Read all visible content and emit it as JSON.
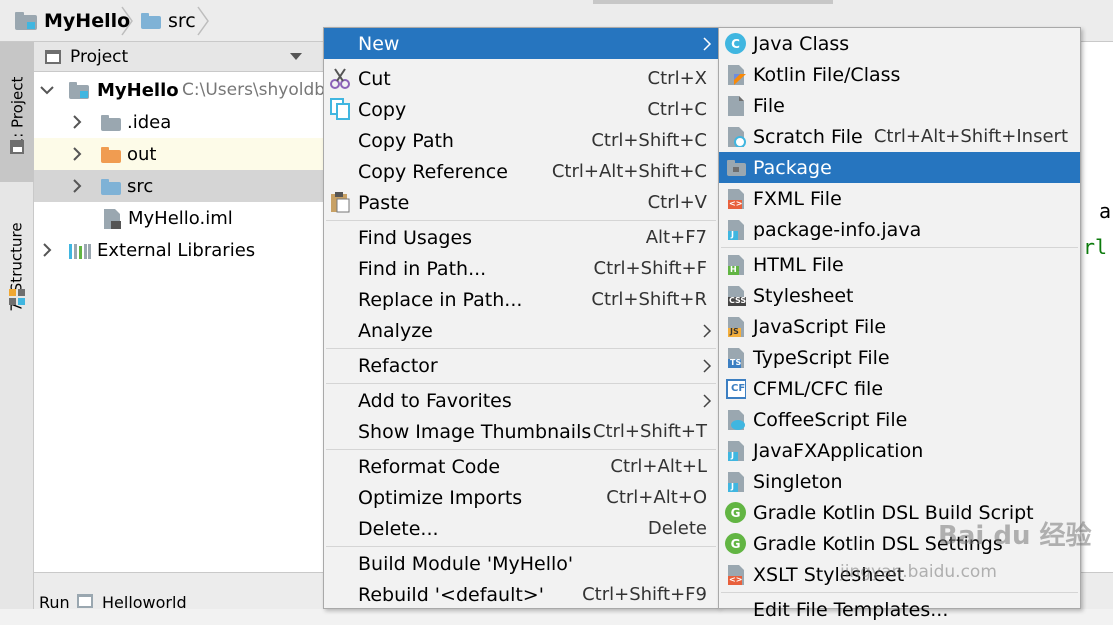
{
  "breadcrumb": {
    "project": "MyHello",
    "folder": "src"
  },
  "tool_windows": {
    "project_tab": "1: Project",
    "structure_tab": "7: Structure"
  },
  "project_panel": {
    "header": "Project",
    "tree": [
      {
        "name": "MyHello",
        "path": "C:\\Users\\shyoldb",
        "icon": "module-folder-icon"
      },
      {
        "name": ".idea",
        "icon": "folder-icon"
      },
      {
        "name": "out",
        "icon": "excluded-folder-icon"
      },
      {
        "name": "src",
        "icon": "source-folder-icon"
      },
      {
        "name": "MyHello.iml",
        "icon": "iml-file-icon"
      },
      {
        "name": "External Libraries",
        "icon": "libraries-icon"
      }
    ]
  },
  "editor_fragment": {
    "line1": "a",
    "line2": "rl"
  },
  "bottom_bar": {
    "run": "Run",
    "config": "Helloworld"
  },
  "context_menu": {
    "items": [
      {
        "label": "New",
        "shortcut": "",
        "submenu": true
      },
      {
        "label": "Cut",
        "shortcut": "Ctrl+X"
      },
      {
        "label": "Copy",
        "shortcut": "Ctrl+C"
      },
      {
        "label": "Copy Path",
        "shortcut": "Ctrl+Shift+C"
      },
      {
        "label": "Copy Reference",
        "shortcut": "Ctrl+Alt+Shift+C"
      },
      {
        "label": "Paste",
        "shortcut": "Ctrl+V"
      },
      {
        "label": "Find Usages",
        "shortcut": "Alt+F7"
      },
      {
        "label": "Find in Path...",
        "shortcut": "Ctrl+Shift+F"
      },
      {
        "label": "Replace in Path...",
        "shortcut": "Ctrl+Shift+R"
      },
      {
        "label": "Analyze",
        "shortcut": "",
        "submenu": true
      },
      {
        "label": "Refactor",
        "shortcut": "",
        "submenu": true
      },
      {
        "label": "Add to Favorites",
        "shortcut": "",
        "submenu": true
      },
      {
        "label": "Show Image Thumbnails",
        "shortcut": "Ctrl+Shift+T"
      },
      {
        "label": "Reformat Code",
        "shortcut": "Ctrl+Alt+L"
      },
      {
        "label": "Optimize Imports",
        "shortcut": "Ctrl+Alt+O"
      },
      {
        "label": "Delete...",
        "shortcut": "Delete"
      },
      {
        "label": "Build Module 'MyHello'",
        "shortcut": ""
      },
      {
        "label": "Rebuild '<default>'",
        "shortcut": "Ctrl+Shift+F9"
      }
    ]
  },
  "new_submenu": {
    "items": [
      {
        "label": "Java Class",
        "shortcut": ""
      },
      {
        "label": "Kotlin File/Class",
        "shortcut": ""
      },
      {
        "label": "File",
        "shortcut": ""
      },
      {
        "label": "Scratch File",
        "shortcut": "Ctrl+Alt+Shift+Insert"
      },
      {
        "label": "Package",
        "shortcut": ""
      },
      {
        "label": "FXML File",
        "shortcut": ""
      },
      {
        "label": "package-info.java",
        "shortcut": ""
      },
      {
        "label": "HTML File",
        "shortcut": ""
      },
      {
        "label": "Stylesheet",
        "shortcut": ""
      },
      {
        "label": "JavaScript File",
        "shortcut": ""
      },
      {
        "label": "TypeScript File",
        "shortcut": ""
      },
      {
        "label": "CFML/CFC file",
        "shortcut": ""
      },
      {
        "label": "CoffeeScript File",
        "shortcut": ""
      },
      {
        "label": "JavaFXApplication",
        "shortcut": ""
      },
      {
        "label": "Singleton",
        "shortcut": ""
      },
      {
        "label": "Gradle Kotlin DSL Build Script",
        "shortcut": ""
      },
      {
        "label": "Gradle Kotlin DSL Settings",
        "shortcut": ""
      },
      {
        "label": "XSLT Stylesheet",
        "shortcut": ""
      },
      {
        "label": "Edit File Templates...",
        "shortcut": ""
      }
    ],
    "icon_badges": {
      "java": "C",
      "html": "H",
      "css": "CSS",
      "js": "JS",
      "ts": "TS",
      "cf": "CF",
      "j": "J",
      "g": "G",
      "xml": "<>"
    }
  },
  "watermark": {
    "brand": "Bai du 经验",
    "url": "jingyan.baidu.com"
  },
  "colors": {
    "selection": "#2675bf",
    "folder_blue": "#7fb2d6",
    "folder_orange": "#f09c51",
    "folder_gray": "#9aa7b0"
  }
}
